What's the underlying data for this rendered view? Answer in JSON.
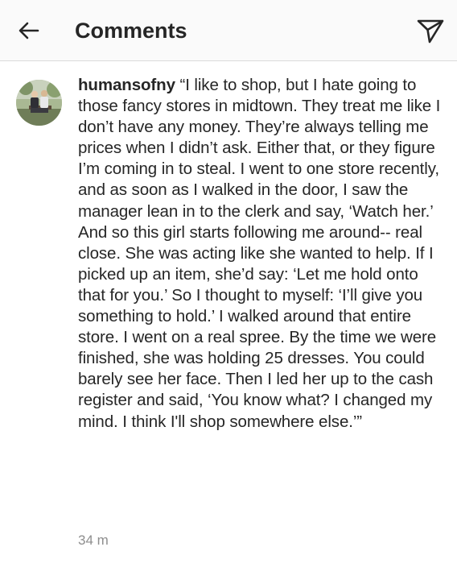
{
  "header": {
    "title": "Comments",
    "back_icon": "arrow-left-icon",
    "share_icon": "paper-plane-icon"
  },
  "comment": {
    "avatar_icon": "avatar-photo",
    "username": "humansofny",
    "text": "“I like to shop, but I hate going to those fancy stores in midtown. They treat me like I don’t have any money. They’re always telling me prices when I didn’t ask. Either that, or they figure I’m coming in to steal. I went to one store recently, and as soon as I walked in the door, I saw the manager lean in to the clerk and say, ‘Watch her.’ And so this girl starts following me around-- real close. She was acting like she wanted to help. If I picked up an item, she’d say: ‘Let me hold onto that for you.’ So I thought to myself: ‘I’ll give you something to hold.’ I walked around that entire store. I went on a real spree. By the time we were finished, she was holding 25 dresses. You could barely see her face. Then I led her up to the cash register and said, ‘You know what? I changed my mind. I think I'll shop somewhere else.’”",
    "timestamp": "34 m"
  },
  "colors": {
    "text": "#262626",
    "muted": "#8e8e8e",
    "header_bg": "#fafafa",
    "divider": "#dbdbdb"
  }
}
